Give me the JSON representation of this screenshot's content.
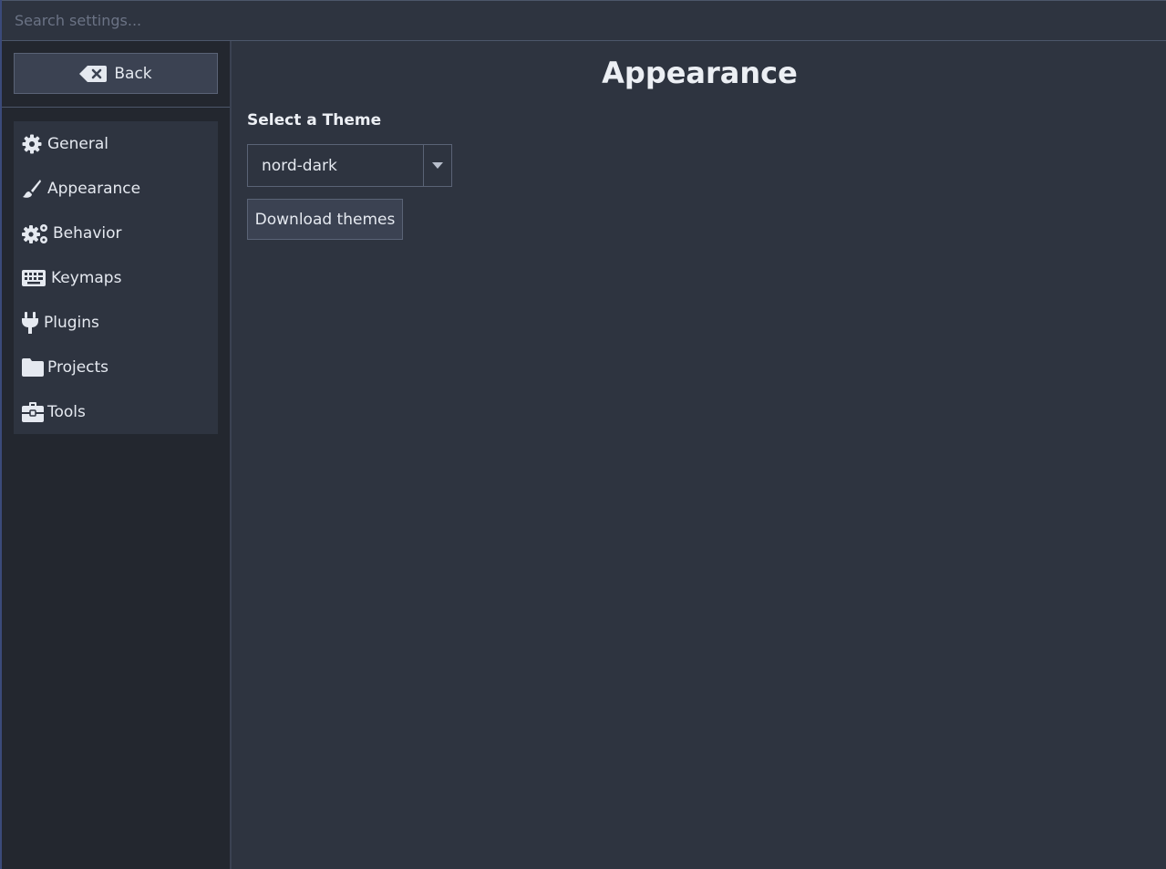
{
  "search": {
    "placeholder": "Search settings...",
    "value": ""
  },
  "sidebar": {
    "back_label": "Back",
    "items": [
      {
        "label": "General",
        "icon": "gear-icon"
      },
      {
        "label": "Appearance",
        "icon": "paintbrush-icon"
      },
      {
        "label": "Behavior",
        "icon": "gears-icon"
      },
      {
        "label": "Keymaps",
        "icon": "keyboard-icon"
      },
      {
        "label": "Plugins",
        "icon": "plug-icon"
      },
      {
        "label": "Projects",
        "icon": "folder-icon"
      },
      {
        "label": "Tools",
        "icon": "toolbox-icon"
      }
    ]
  },
  "main": {
    "title": "Appearance",
    "theme_label": "Select a Theme",
    "theme_value": "nord-dark",
    "download_label": "Download themes"
  },
  "colors": {
    "background": "#2e3440",
    "sidebar": "#23272f",
    "button": "#3b4252",
    "border": "#5a6376",
    "text": "#e5e9f0"
  }
}
